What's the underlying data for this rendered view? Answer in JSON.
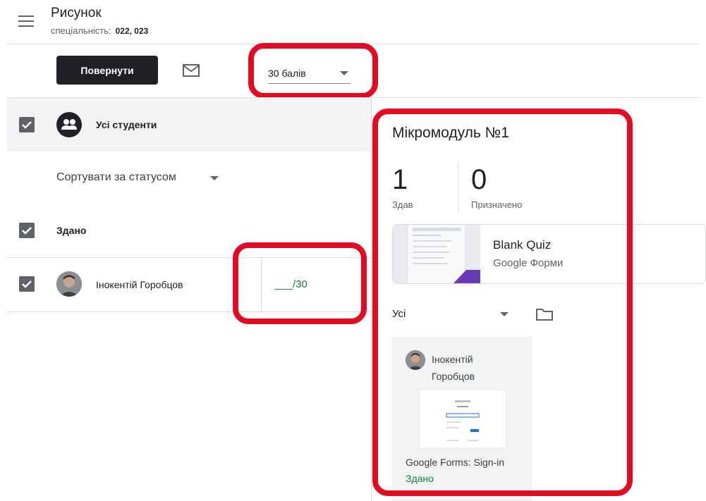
{
  "header": {
    "title": "Рисунок",
    "subtitle_label": "спеціальність:",
    "subtitle_value": "022, 023"
  },
  "toolbar": {
    "return_label": "Повернути",
    "points_label": "30 балів"
  },
  "list": {
    "all_students_label": "Усі студенти",
    "sort_label": "Сортувати за статусом",
    "section_label": "Здано",
    "students": [
      {
        "name": "Інокентій Горобцов",
        "grade": "___/30"
      }
    ]
  },
  "panel": {
    "title": "Мікромодуль №1",
    "stats": [
      {
        "value": "1",
        "label": "Здав"
      },
      {
        "value": "0",
        "label": "Призначено"
      }
    ],
    "attachment": {
      "name": "Blank Quiz",
      "type": "Google Форми"
    },
    "filter_label": "Усі",
    "submission": {
      "student_name": "Інокентій Горобцов",
      "file_title": "Google Forms: Sign-in",
      "status": "Здано"
    }
  },
  "colors": {
    "highlight": "#e30b23",
    "dark": "#202124",
    "success": "#188038",
    "forms_accent": "#673ab7"
  },
  "icons": [
    "menu-icon",
    "mail-icon",
    "dropdown-arrow-icon",
    "people-icon",
    "checkbox-checked-icon",
    "folder-icon"
  ]
}
